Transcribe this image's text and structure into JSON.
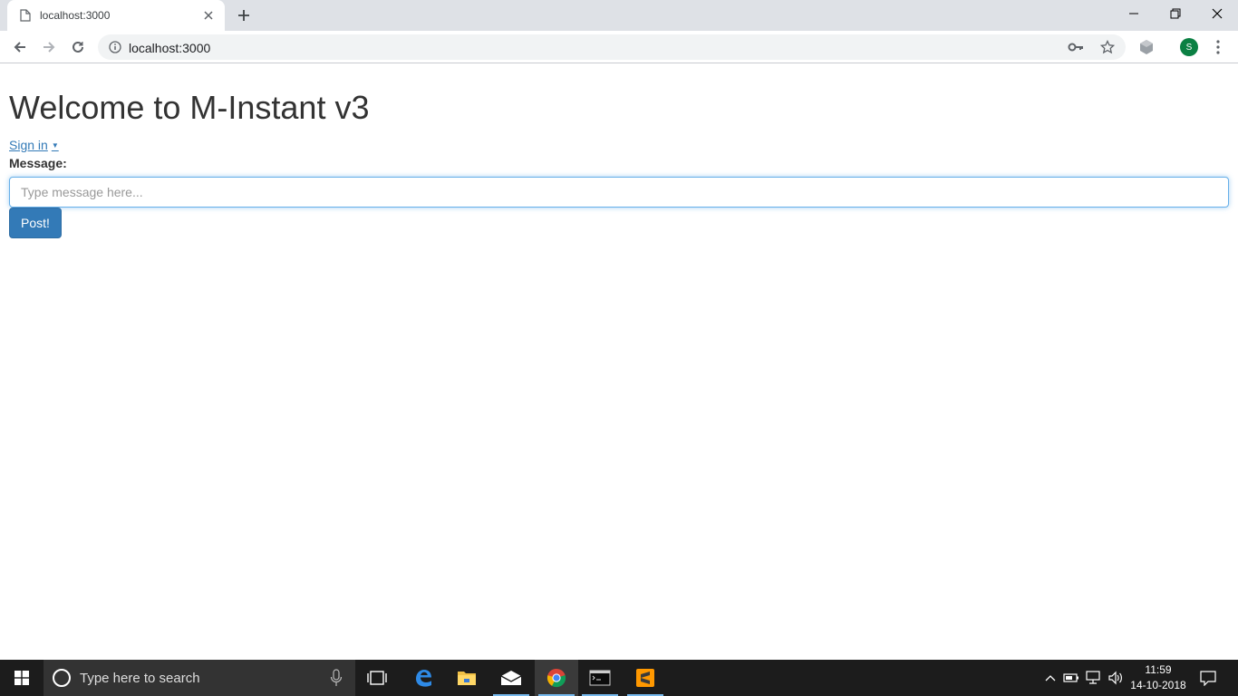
{
  "browser": {
    "tab_title": "localhost:3000",
    "url": "localhost:3000",
    "profile_initial": "S"
  },
  "page": {
    "heading": "Welcome to M-Instant v3",
    "signin_label": "Sign in",
    "message_label": "Message:",
    "message_placeholder": "Type message here...",
    "post_label": "Post!"
  },
  "taskbar": {
    "search_placeholder": "Type here to search",
    "time": "11:59",
    "date": "14-10-2018"
  },
  "colors": {
    "primary": "#337ab7",
    "input_focus": "#66afe9",
    "taskbar": "#1c1c1c",
    "tabstrip": "#dee1e6"
  }
}
